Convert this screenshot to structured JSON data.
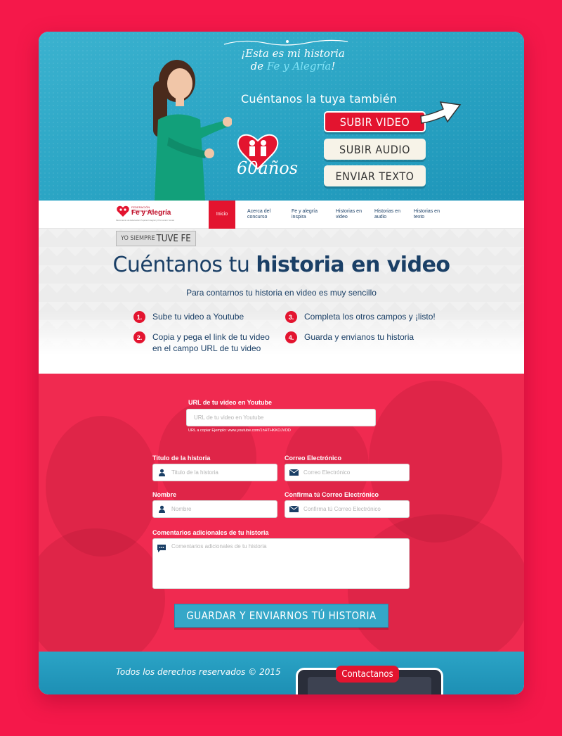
{
  "hero": {
    "tagline_line1": "¡Esta es mi historia",
    "tagline_line2_prefix": "de ",
    "tagline_line2_highlight": "Fe y Alegría",
    "tagline_line2_suffix": "!",
    "tagline_sub": "Cuéntanos la tuya también",
    "logo_text": "FE Y ALEGRIA",
    "anniversary": "60años",
    "buttons": {
      "video": "SUBIR VIDEO",
      "audio": "SUBIR AUDIO",
      "texto": "ENVIAR TEXTO"
    }
  },
  "nav": {
    "logo_line1": "FEDERACIÓN INTERNACIONAL",
    "logo_line2": "Fe y Alegría",
    "logo_line3": "Movimiento de Educación Popular Integral y Promoción Social",
    "items": [
      {
        "label": "Inicio"
      },
      {
        "label": "Acerca del concurso"
      },
      {
        "label": "Fe y alegría inspira"
      },
      {
        "label": "Historias en video"
      },
      {
        "label": "Historias en audio"
      },
      {
        "label": "Historias en texto"
      }
    ]
  },
  "steps": {
    "ribbon_small": "YO SIEMPRE",
    "ribbon_big": "TUVE FE",
    "title_plain": "Cuéntanos tu ",
    "title_bold": "historia en video",
    "subtitle": "Para contarnos tu historia en video es muy sencillo",
    "items": [
      {
        "num": "1.",
        "text": "Sube tu video a Youtube"
      },
      {
        "num": "2.",
        "text": "Copia y pega el link de tu video en el campo URL de tu video"
      },
      {
        "num": "3.",
        "text": "Completa los otros campos y ¡listo!"
      },
      {
        "num": "4.",
        "text": "Guarda y envianos tu historia"
      }
    ]
  },
  "form": {
    "url_label": "URL de tu video en Youtube",
    "url_placeholder": "URL de tu video en Youtube",
    "url_hint": "URL a copiar Ejemplo: www.youtube.com/1hHTHKKOJVDD",
    "titulo_label": "Titulo de la historia",
    "titulo_placeholder": "Titulo de la historia",
    "correo_label": "Correo Electrónico",
    "correo_placeholder": "Correo Electrónico",
    "nombre_label": "Nombre",
    "nombre_placeholder": "Nombre",
    "confirma_label": "Confirma tú Correo Electrónico",
    "confirma_placeholder": "Confirma tú Correo Electrónico",
    "comentarios_label": "Comentarios adicionales de tu historia",
    "comentarios_placeholder": "Comentarios adicionales de tu historia",
    "submit_label": "GUARDAR Y ENVIARNOS TÚ HISTORIA"
  },
  "footer": {
    "copyright": "Todos los derechos reservados © 2015",
    "contact_label": "Contactanos"
  },
  "colors": {
    "page_bg": "#f5184a",
    "brand_red": "#e3142f",
    "hero_blue": "#2ba4c6",
    "navy_text": "#1a3f66"
  }
}
